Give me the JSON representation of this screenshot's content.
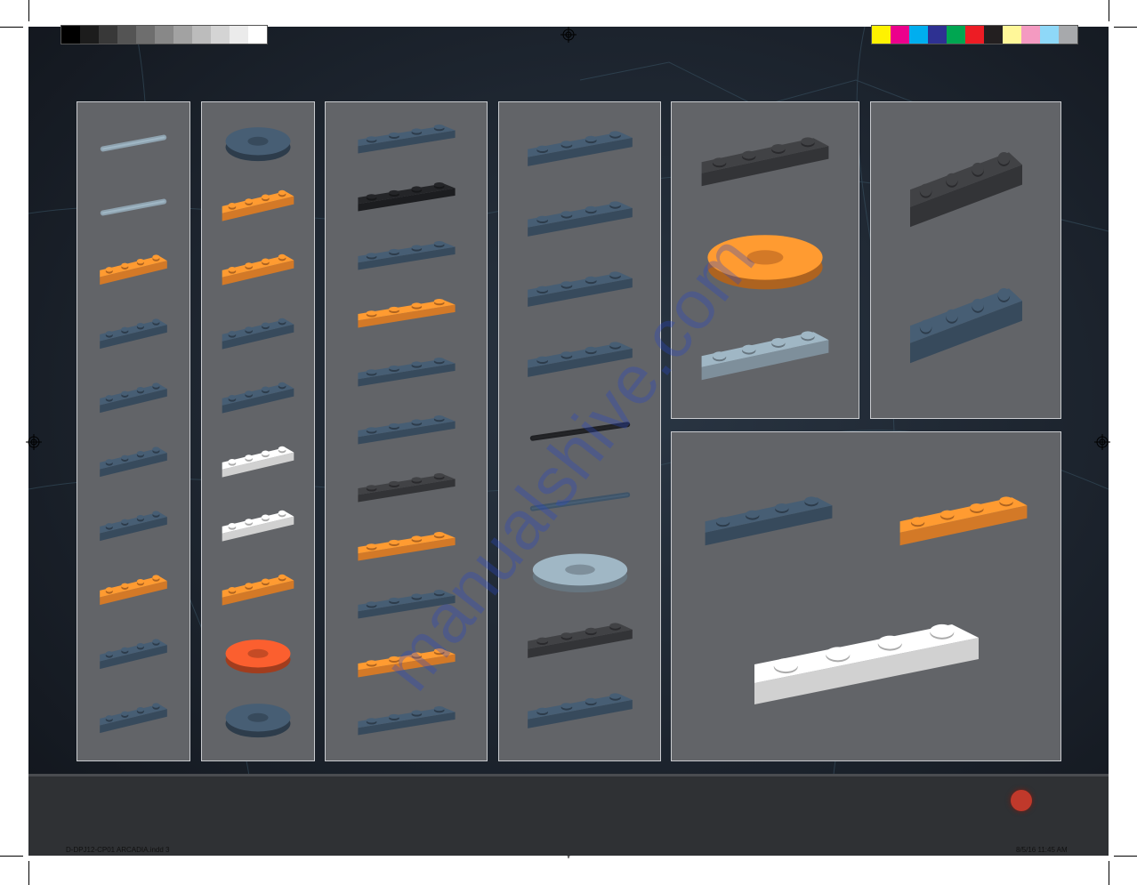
{
  "colors": {
    "page_bg": "#161b24",
    "panel_bg": "#626468",
    "panel_border": "#c9cbcf",
    "brick_blue_grey": "#3f5468",
    "brick_orange": "#f08a2c",
    "brick_black": "#202124",
    "brick_white": "#eeeeee",
    "brick_dark_grey": "#3a3b3e",
    "brick_light_grey": "#8fa3b0",
    "brick_red_orange": "#e0552a"
  },
  "grey_swatches": [
    "#000000",
    "#1c1c1c",
    "#383838",
    "#545454",
    "#6e6e6e",
    "#888888",
    "#a2a2a2",
    "#bcbcbc",
    "#d4d4d4",
    "#ebebeb",
    "#ffffff"
  ],
  "color_swatches": [
    "#fff200",
    "#ec008c",
    "#00aeef",
    "#2e3192",
    "#00a651",
    "#ed1c24",
    "#231f20",
    "#fff799",
    "#f49ac1",
    "#8ed8f8",
    "#a7a9ac"
  ],
  "parts_panels": [
    {
      "id": "panel-1",
      "parts": [
        "bar-light-grey",
        "bar-with-handle-clear",
        "plate-1x4-orange",
        "plate-1x4-blue-grey",
        "tile-1x4-blue-grey",
        "bracket-1x4-blue-grey",
        "brick-1x4-blue-grey",
        "brick-1x4-studs-orange",
        "brick-1x4-studs-blue-grey",
        "slope-1x4-blue-grey"
      ]
    },
    {
      "id": "panel-2",
      "parts": [
        "technic-axle-connector",
        "wedge-plate-2x4-orange-left",
        "wedge-plate-2x4-orange-right",
        "wedge-plate-2x4-blue-grey-left",
        "wedge-plate-2x4-blue-grey-right",
        "wing-plate-white-left",
        "wing-plate-white-right",
        "plate-2x4-orange",
        "dish-radar-red-orange",
        "dish-4x4-blue-grey"
      ]
    },
    {
      "id": "panel-3",
      "parts": [
        "plate-1x6-blue-grey",
        "wedge-1x6-black",
        "triangle-tile-blue-grey",
        "triangle-tile-orange",
        "tile-1x6-blue-grey",
        "brick-1x6-blue-grey",
        "plate-2x6-dark-grey",
        "plate-2x6-orange",
        "plate-2x6-blue-grey",
        "wedge-plate-2x6-orange",
        "wedge-plate-2x6-blue-grey"
      ]
    },
    {
      "id": "panel-4",
      "parts": [
        "plate-4x4-blue-grey",
        "wedge-plate-4x4-blue-grey-left",
        "wedge-plate-4x4-blue-grey-right",
        "tile-1x8-blue-grey",
        "bar-long-black",
        "bar-long-blue-grey",
        "connector-clear",
        "plate-1x8-dark-grey",
        "windscreen-blue-grey"
      ]
    },
    {
      "id": "panel-5",
      "parts": [
        "oval-frame-dark-grey",
        "cylinder-orange-blue-grey",
        "rail-bracket-light-grey"
      ]
    },
    {
      "id": "panel-6",
      "parts": [
        "curved-frame-dark-grey",
        "panel-1x4x6-blue-grey"
      ]
    },
    {
      "id": "panel-7",
      "parts": [
        "wedge-plate-6x6-blue-grey",
        "wedge-plate-6x8-orange",
        "tri-base-plate-white"
      ]
    }
  ],
  "footer": {
    "file_name": "D-DPJ12-CP01 ARCADIA.indd   3",
    "date_time": "8/5/16   11:45 AM"
  },
  "watermark": "manualshive.com"
}
